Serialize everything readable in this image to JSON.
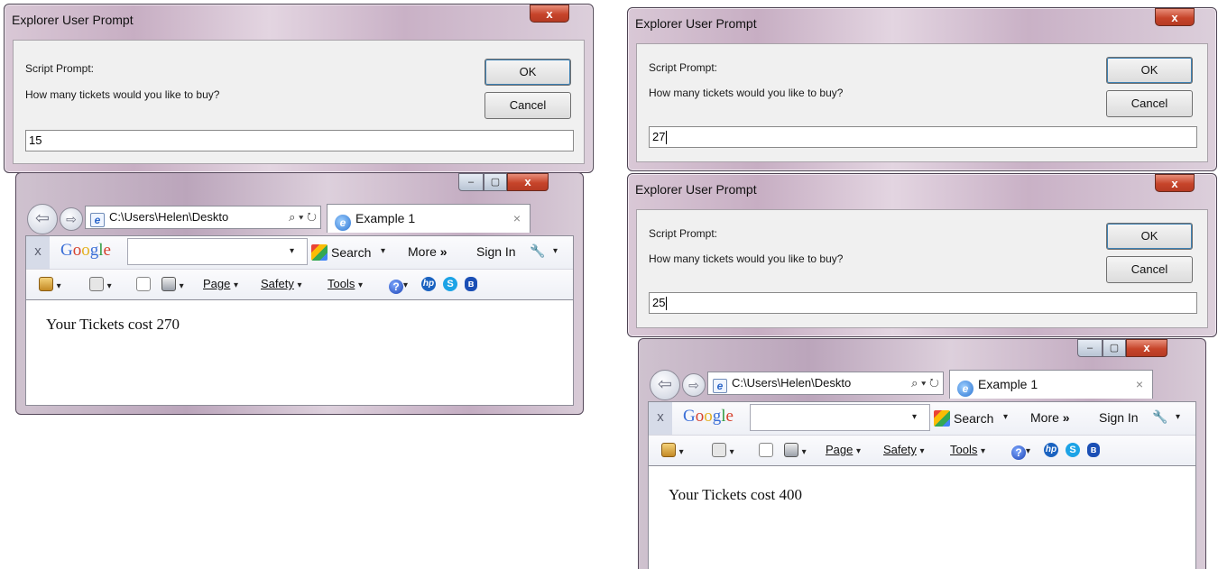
{
  "dialog_title": "Explorer User Prompt",
  "close_glyph": "x",
  "prompt_label": "Script Prompt:",
  "question": "How many tickets would you like to buy?",
  "ok_label": "OK",
  "cancel_label": "Cancel",
  "dialogs": [
    {
      "input_value": "15"
    },
    {
      "input_value": "27"
    },
    {
      "input_value": "25"
    }
  ],
  "browser": {
    "address": "C:\\Users\\Helen\\Deskto",
    "address_tools": "⌕ ▾ ↻",
    "tab_title": "Example 1",
    "tab_close": "×",
    "min_glyph": "–",
    "max_glyph": "▢",
    "close_glyph": "x",
    "back_glyph": "⇦",
    "forward_glyph": "⇨",
    "google_close": "x",
    "google_logo": "Google",
    "google_search_label": "Search",
    "more_label": "More",
    "more_glyph": "»",
    "sign_in_label": "Sign In",
    "wrench_glyph": "🔧",
    "dropdown_glyph": "▾",
    "page_menu": "Page",
    "safety_menu": "Safety",
    "tools_menu": "Tools",
    "help_glyph": "?",
    "hp_glyph": "hp",
    "skype_glyph": "S",
    "bluetooth_glyph": "ʙ",
    "windows": [
      {
        "result_text": "Your Tickets cost 270"
      },
      {
        "result_text": "Your Tickets cost 400"
      }
    ]
  }
}
